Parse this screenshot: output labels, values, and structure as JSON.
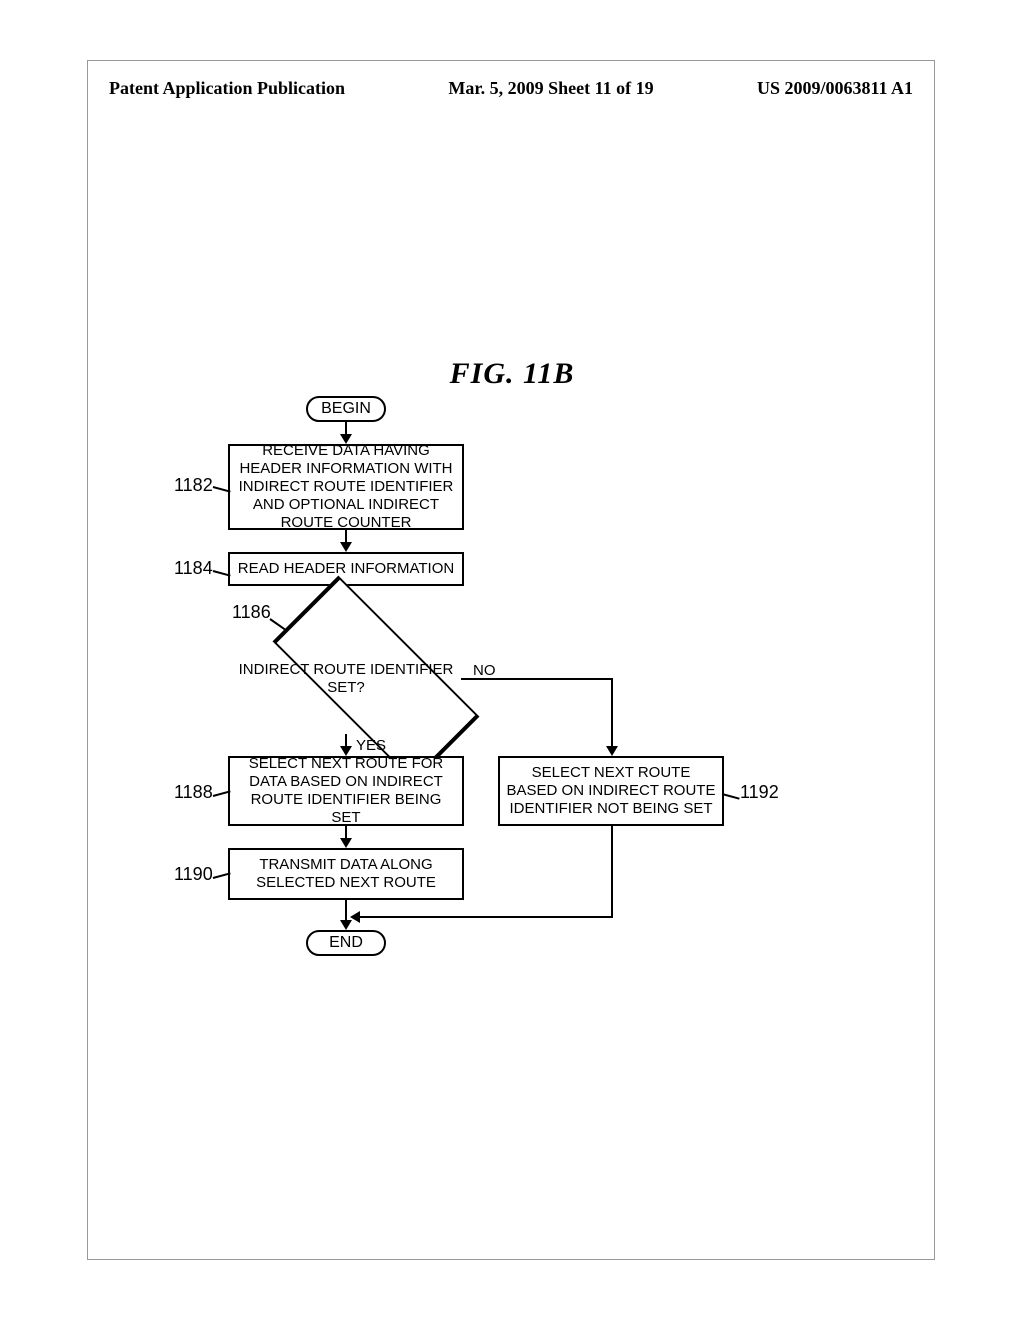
{
  "header": {
    "left": "Patent Application Publication",
    "center": "Mar. 5, 2009  Sheet 11 of 19",
    "right": "US 2009/0063811 A1"
  },
  "figure": {
    "title": "FIG. 11B",
    "begin": "BEGIN",
    "end": "END",
    "step_1182": "RECEIVE DATA HAVING HEADER INFORMATION WITH INDIRECT ROUTE IDENTIFIER AND OPTIONAL INDIRECT ROUTE COUNTER",
    "step_1184": "READ HEADER INFORMATION",
    "decision_1186": "INDIRECT ROUTE IDENTIFIER SET?",
    "branch_yes": "YES",
    "branch_no": "NO",
    "step_1188": "SELECT NEXT ROUTE FOR DATA BASED ON INDIRECT ROUTE IDENTIFIER BEING SET",
    "step_1190": "TRANSMIT DATA ALONG SELECTED NEXT ROUTE",
    "step_1192": "SELECT NEXT ROUTE BASED ON INDIRECT ROUTE IDENTIFIER NOT BEING SET",
    "ref_1182": "1182",
    "ref_1184": "1184",
    "ref_1186": "1186",
    "ref_1188": "1188",
    "ref_1190": "1190",
    "ref_1192": "1192"
  }
}
